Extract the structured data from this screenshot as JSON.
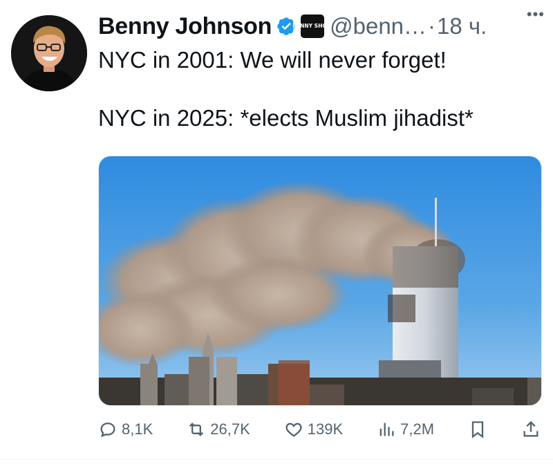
{
  "author": {
    "name": "Benny Johnson",
    "handle": "@benn…",
    "time": "18 ч.",
    "separator": "·",
    "badge_text": "BENNY SHOW"
  },
  "more_icon": "more-horizontal-icon",
  "tweet": {
    "line1": "NYC in 2001: We will never forget!",
    "line2": "NYC in 2025: *elects Muslim jihadist*"
  },
  "actions": {
    "replies": "8,1K",
    "reposts": "26,7K",
    "likes": "139K",
    "views": "7,2M"
  },
  "colors": {
    "verified": "#1d9bf0",
    "secondary_text": "#536471",
    "primary_text": "#0f1419",
    "sky": "#3f93d8"
  }
}
